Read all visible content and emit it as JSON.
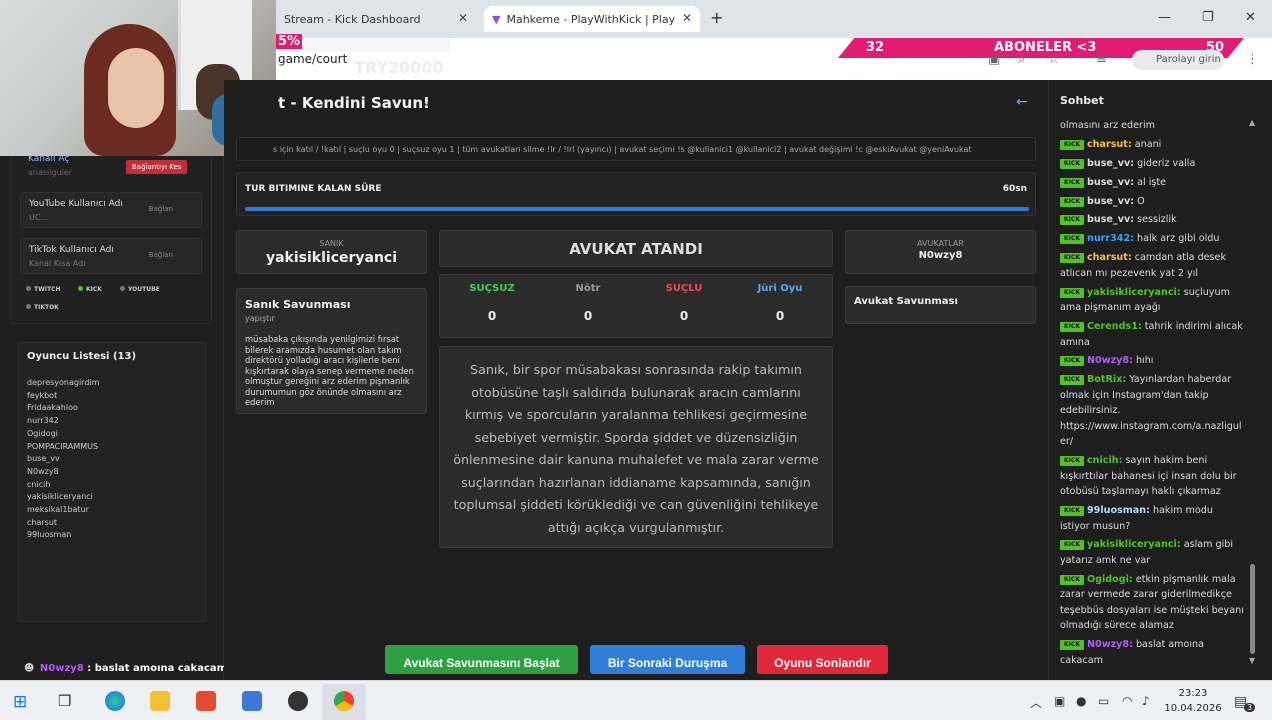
{
  "browser": {
    "tab1_title": "Stream - Kick Dashboard",
    "tab2_title": "Mahkeme - PlayWithKick | Play",
    "url": "game/court",
    "profile_label": "Parolayı girin",
    "overlay_percent": "5%",
    "overlay_code": "TRY20000"
  },
  "banner": {
    "left": "32",
    "center": "ABONELER <3",
    "right": "50"
  },
  "left_panel": {
    "kanal_label": "Kanalı Aç",
    "kanal_sub": "anasilguler",
    "disconnect_label": "Bağlantıyı Kes",
    "youtube": {
      "title": "YouTube Kullanıcı Adı",
      "sub": "UC...",
      "btn": "Bağlan"
    },
    "tiktok": {
      "title": "TikTok Kullanıcı Adı",
      "sub": "Kanal Kısa Adı",
      "btn": "Bağlan"
    },
    "platforms": [
      "TWITCH",
      "KICK",
      "YOUTUBE",
      "TIKTOK"
    ],
    "player_list_title": "Oyuncu Listesi (13)",
    "players": [
      "depresyonagirdim",
      "feykbot",
      "Fridaakahloo",
      "nurr342",
      "Ogidogi",
      "POMPACIRAMMUS",
      "buse_vv",
      "N0wzy8",
      "cnicih",
      "yakisikliceryanci",
      "meksikal1batur",
      "charsut",
      "99luosman"
    ],
    "bottom_user": "N0wzy8",
    "bottom_msg": " : baslat amoına cakacam"
  },
  "main": {
    "title": "t - Kendini Savun!",
    "commands": "s için katıl / !katıl | suçlu oyu 0 | suçsuz oyu 1 | tüm avukatları silme !lr / !lrl (yayıncı) | avukat seçimi !s @kullanici1 @kullanici2 | avukat değişimi !c @eskiAvukat @yeniAvukat",
    "timer_label": "TUR BITIMINE KALAN SÜRE",
    "timer_value": "60sn",
    "timer_fraction": 1.0,
    "defendant_label": "SANIK",
    "defendant_name": "yakisikliceryanci",
    "defense_title": "Sanık Savunması",
    "defense_status": "yapıştır",
    "defense_text": "müsabaka çıkışında yenilgimizi fırsat bilerek aramızda husumet olan takım direktörü yolladığı aracı kişilerle beni kışkırtarak olaya senep vermeme neden olmuştur gereğini arz ederim pişmanlık durumumun göz önünde olmasını arz ederim",
    "verdict": "AVUKAT ATANDI",
    "votes": [
      {
        "label": "SUÇSUZ",
        "count": "0",
        "color": "#3ecf5c"
      },
      {
        "label": "Nötr",
        "count": "0",
        "color": "#999999"
      },
      {
        "label": "SUÇLU",
        "count": "0",
        "color": "#f0485a"
      },
      {
        "label": "Jüri Oyu",
        "count": "0",
        "color": "#5aa8f0"
      }
    ],
    "case_text": "Sanık, bir spor müsabakası sonrasında rakip takımın otobüsüne taşlı saldırıda bulunarak aracın camlarını kırmış ve sporcuların yaralanma tehlikesi geçirmesine sebebiyet vermiştir. Sporda şiddet ve düzensizliğin önlenmesine dair kanuna muhalefet ve mala zarar verme suçlarından hazırlanan iddianame kapsamında, sanığın toplumsal şiddeti körüklediği ve can güvenliğini tehlikeye attığı açıkça vurgulanmıştır.",
    "lawyers_label": "AVUKATLAR",
    "lawyers_name": "N0wzy8",
    "lawyer_defense_title": "Avukat Savunması",
    "buttons": {
      "start": "Avukat Savunmasını Başlat",
      "next": "Bir Sonraki Duruşma",
      "end": "Oyunu Sonlandır"
    }
  },
  "chat": {
    "title": "Sohbet",
    "badge": "KICK",
    "messages": [
      {
        "user": "",
        "color": "#ffffff",
        "text": "olmasını arz ederim",
        "badge": false
      },
      {
        "user": "charsut:",
        "color": "#f5c242",
        "text": " anani",
        "badge": true
      },
      {
        "user": "buse_vv:",
        "color": "#dddddd",
        "text": " gideriz valla",
        "badge": true
      },
      {
        "user": "buse_vv:",
        "color": "#dddddd",
        "text": " al işte",
        "badge": true
      },
      {
        "user": "buse_vv:",
        "color": "#dddddd",
        "text": " O",
        "badge": true
      },
      {
        "user": "buse_vv:",
        "color": "#dddddd",
        "text": " sessizlik",
        "badge": true
      },
      {
        "user": "nurr342:",
        "color": "#3aa0ff",
        "text": " halk arz gibi oldu",
        "badge": true
      },
      {
        "user": "charsut:",
        "color": "#f5c242",
        "text": " camdan atla desek atlıcan mı pezevenk yat 2 yıl",
        "badge": true
      },
      {
        "user": "yakisikliceryanci:",
        "color": "#53c228",
        "text": " suçluyum ama pişmanım ayağı",
        "badge": true
      },
      {
        "user": "Cerends1:",
        "color": "#53c228",
        "text": " tahrik indirimi alıcak amına",
        "badge": true
      },
      {
        "user": "N0wzy8:",
        "color": "#b45cf5",
        "text": " hıhı",
        "badge": true
      },
      {
        "user": "BotRix:",
        "color": "#53c228",
        "text": " Yayınlardan haberdar olmak için Instagram'dan takip edebilirsiniz. https://www.instagram.com/a.nazligul er/",
        "badge": true
      },
      {
        "user": "cnicih:",
        "color": "#53c228",
        "text": " sayın hakim beni kışkırttılar bahanesi içi insan dolu bir otobüsü taşlamayı haklı çıkarmaz",
        "badge": true
      },
      {
        "user": "99luosman:",
        "color": "#b9d9ff",
        "text": " hakim modu istiyor musun?",
        "badge": true
      },
      {
        "user": "yakisikliceryanci:",
        "color": "#53c228",
        "text": " aslam gibi yatarız amk ne var",
        "badge": true
      },
      {
        "user": "Ogidogi:",
        "color": "#53c228",
        "text": " etkin pişmanlık mala zarar vermede zarar giderilmedikçe teşebbüs dosyaları ise müşteki beyanı olmadığı sürece alamaz",
        "badge": true
      },
      {
        "user": "N0wzy8:",
        "color": "#b45cf5",
        "text": " baslat amoına cakacam",
        "badge": true
      }
    ]
  },
  "taskbar": {
    "time": "23:23",
    "date": "10.04.2026",
    "notif_count": "3"
  },
  "colors": {
    "kick_green": "#53c228",
    "accent_blue": "#2f7fd9",
    "pink": "#e01c73"
  }
}
